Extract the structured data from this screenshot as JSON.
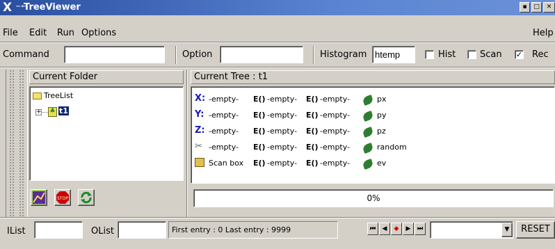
{
  "window": {
    "title": "TreeViewer"
  },
  "menu": {
    "file": "File",
    "edit": "Edit",
    "run": "Run",
    "options": "Options",
    "help": "Help"
  },
  "toolbar": {
    "command_label": "Command",
    "command_value": "",
    "option_label": "Option",
    "option_value": "",
    "histogram_label": "Histogram",
    "histogram_value": "htemp",
    "hist_label": "Hist",
    "hist_checked": false,
    "scan_label": "Scan",
    "scan_checked": false,
    "rec_label": "Rec",
    "rec_checked": true
  },
  "left_panel": {
    "header": "Current Folder",
    "tree": [
      {
        "label": "TreeList"
      },
      {
        "label": "t1"
      }
    ]
  },
  "right_panel": {
    "header": "Current Tree : t1",
    "rows": [
      {
        "axis": "X:",
        "axis_value": "-empty-",
        "e1": "E()",
        "e1_value": "-empty-",
        "e2": "E()",
        "e2_value": "-empty-",
        "leaf": "px"
      },
      {
        "axis": "Y:",
        "axis_value": "-empty-",
        "e1": "E()",
        "e1_value": "-empty-",
        "e2": "E()",
        "e2_value": "-empty-",
        "leaf": "py"
      },
      {
        "axis": "Z:",
        "axis_value": "-empty-",
        "e1": "E()",
        "e1_value": "-empty-",
        "e2": "E()",
        "e2_value": "-empty-",
        "leaf": "pz"
      },
      {
        "axis": "",
        "axis_value": "-empty-",
        "e1": "E()",
        "e1_value": "-empty-",
        "e2": "E()",
        "e2_value": "-empty-",
        "leaf": "random"
      },
      {
        "axis": "Scan box",
        "axis_value": "",
        "e1": "E()",
        "e1_value": "-empty-",
        "e2": "E()",
        "e2_value": "-empty-",
        "leaf": "ev"
      }
    ],
    "progress": "0%",
    "progress_fraction": 0
  },
  "bottom": {
    "ilist_label": "IList",
    "ilist_value": "",
    "olist_label": "OList",
    "olist_value": "",
    "entries": "First entry : 0 Last entry : 9999",
    "reset_label": "RESET"
  },
  "colors": {
    "titlebar": "#2a4fa0",
    "axis_blue": "#1a1ab4",
    "stop_red": "#cc0000",
    "leaf_green": "#2f7d2f"
  }
}
